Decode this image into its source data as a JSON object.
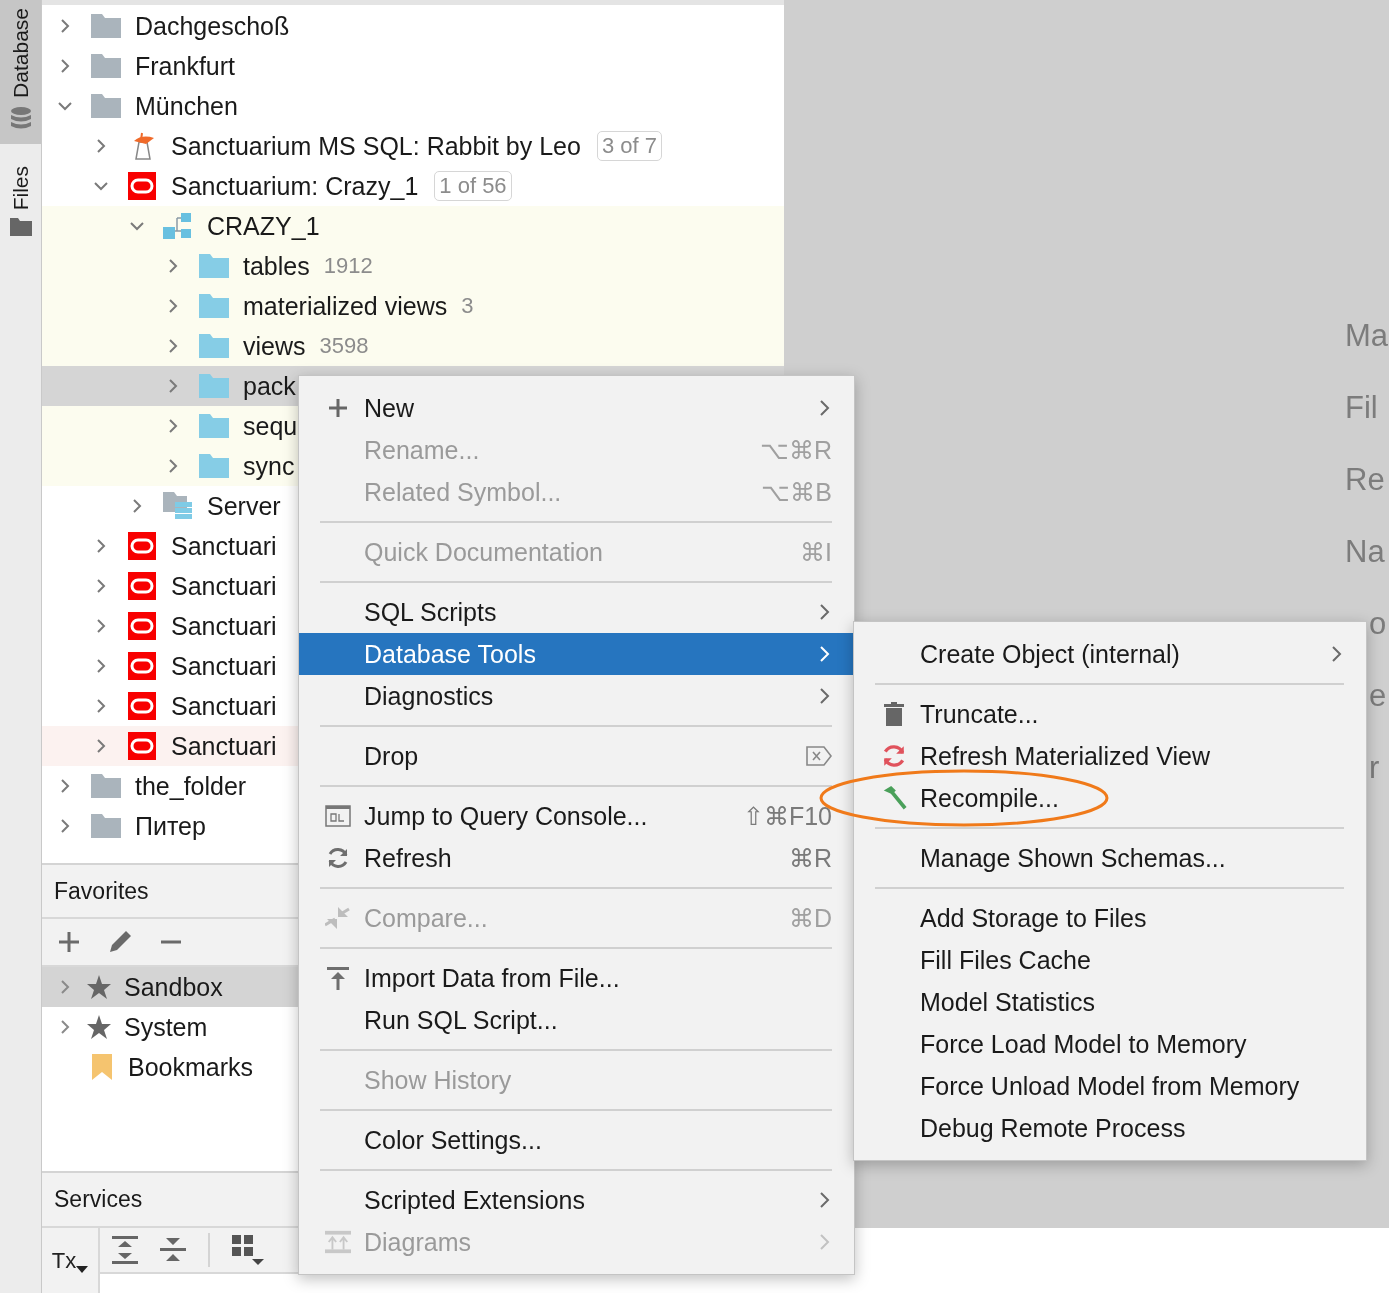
{
  "tool_strip": [
    {
      "label": "Database",
      "selected": true
    },
    {
      "label": "Files",
      "selected": false
    }
  ],
  "tree": [
    {
      "label": "Dachgeschoß",
      "kind": "folder",
      "expanded": false
    },
    {
      "label": "Frankfurt",
      "kind": "folder",
      "expanded": false
    },
    {
      "label": "München",
      "kind": "folder",
      "expanded": true,
      "children": [
        {
          "label": "Sanctuarium MS SQL: Rabbit by Leo",
          "kind": "mssql",
          "expanded": false,
          "badge": "3 of 7"
        },
        {
          "label": "Sanctuarium: Crazy_1",
          "kind": "oracle",
          "expanded": true,
          "badge": "1 of 56",
          "children": [
            {
              "label": "CRAZY_1",
              "kind": "schema",
              "expanded": true,
              "color": "#fcfcef",
              "children": [
                {
                  "label": "tables",
                  "kind": "group",
                  "expanded": false,
                  "count": "1912",
                  "color": "#fcfcef"
                },
                {
                  "label": "materialized views",
                  "kind": "group",
                  "expanded": false,
                  "count": "3",
                  "color": "#fcfcef"
                },
                {
                  "label": "views",
                  "kind": "group",
                  "expanded": false,
                  "count": "3598",
                  "color": "#fcfcef"
                },
                {
                  "label": "pack",
                  "kind": "group",
                  "expanded": false,
                  "selected": true
                },
                {
                  "label": "sequ",
                  "kind": "group",
                  "expanded": false,
                  "color": "#fcfcef"
                },
                {
                  "label": "sync",
                  "kind": "group",
                  "expanded": false,
                  "color": "#fcfcef"
                }
              ]
            },
            {
              "label": "Server",
              "kind": "server",
              "expanded": false
            }
          ]
        },
        {
          "label": "Sanctuari",
          "kind": "oracle",
          "expanded": false
        },
        {
          "label": "Sanctuari",
          "kind": "oracle",
          "expanded": false
        },
        {
          "label": "Sanctuari",
          "kind": "oracle",
          "expanded": false
        },
        {
          "label": "Sanctuari",
          "kind": "oracle",
          "expanded": false
        },
        {
          "label": "Sanctuari",
          "kind": "oracle",
          "expanded": false
        },
        {
          "label": "Sanctuari",
          "kind": "oracle",
          "expanded": false,
          "color": "#fcf2f0"
        }
      ]
    },
    {
      "label": "the_folder",
      "kind": "folder",
      "expanded": false
    },
    {
      "label": "Питер",
      "kind": "folder",
      "expanded": false
    }
  ],
  "favorites": {
    "title": "Favorites",
    "items": [
      {
        "label": "Sandbox",
        "kind": "star",
        "expanded": false,
        "selected": true
      },
      {
        "label": "System",
        "kind": "star",
        "expanded": false,
        "selected": false
      },
      {
        "label": "Bookmarks",
        "kind": "bookmark",
        "selected": false
      }
    ]
  },
  "services": {
    "title": "Services",
    "tx_button": "Tx"
  },
  "right_hints": [
    {
      "label": "Ma"
    },
    {
      "label": "Fil"
    },
    {
      "label": "Re"
    },
    {
      "label": "Na"
    },
    {
      "label": "o",
      "kind": "cut"
    },
    {
      "label": "e",
      "kind": "cut"
    },
    {
      "label": "r",
      "kind": "cut"
    }
  ],
  "context_menu": [
    {
      "kind": "item",
      "label": "New",
      "submenu": true,
      "disabled": false,
      "selected": false
    },
    {
      "kind": "item",
      "label": "Rename...",
      "shortcut": "⌥⌘R",
      "disabled": true,
      "selected": false
    },
    {
      "kind": "item",
      "label": "Related Symbol...",
      "shortcut": "⌥⌘B",
      "disabled": true,
      "selected": false
    },
    {
      "kind": "separator"
    },
    {
      "kind": "item",
      "label": "Quick Documentation",
      "shortcut": "⌘I",
      "disabled": true,
      "selected": false
    },
    {
      "kind": "separator"
    },
    {
      "kind": "item",
      "label": "SQL Scripts",
      "submenu": true,
      "disabled": false,
      "selected": false
    },
    {
      "kind": "item",
      "label": "Database Tools",
      "submenu": true,
      "disabled": false,
      "selected": true
    },
    {
      "kind": "item",
      "label": "Diagnostics",
      "submenu": true,
      "disabled": false,
      "selected": false
    },
    {
      "kind": "separator"
    },
    {
      "kind": "item",
      "label": "Drop",
      "disabled": false,
      "selected": false
    },
    {
      "kind": "separator"
    },
    {
      "kind": "item",
      "label": "Jump to Query Console...",
      "shortcut": "⇧⌘F10",
      "disabled": false,
      "selected": false
    },
    {
      "kind": "item",
      "label": "Refresh",
      "shortcut": "⌘R",
      "disabled": false,
      "selected": false
    },
    {
      "kind": "separator"
    },
    {
      "kind": "item",
      "label": "Compare...",
      "shortcut": "⌘D",
      "disabled": true,
      "selected": false
    },
    {
      "kind": "separator"
    },
    {
      "kind": "item",
      "label": "Import Data from File...",
      "disabled": false,
      "selected": false
    },
    {
      "kind": "item",
      "label": "Run SQL Script...",
      "disabled": false,
      "selected": false
    },
    {
      "kind": "separator"
    },
    {
      "kind": "item",
      "label": "Show History",
      "disabled": true,
      "selected": false
    },
    {
      "kind": "separator"
    },
    {
      "kind": "item",
      "label": "Color Settings...",
      "disabled": false,
      "selected": false
    },
    {
      "kind": "separator"
    },
    {
      "kind": "item",
      "label": "Scripted Extensions",
      "submenu": true,
      "disabled": false,
      "selected": false
    },
    {
      "kind": "item",
      "label": "Diagrams",
      "submenu": true,
      "disabled": true,
      "selected": false
    }
  ],
  "submenu": [
    {
      "kind": "item",
      "label": "Create Object (internal)",
      "submenu": true
    },
    {
      "kind": "separator"
    },
    {
      "kind": "item",
      "label": "Truncate..."
    },
    {
      "kind": "item",
      "label": "Refresh Materialized View"
    },
    {
      "kind": "item",
      "label": "Recompile...",
      "circled": true
    },
    {
      "kind": "separator"
    },
    {
      "kind": "item",
      "label": "Manage Shown Schemas..."
    },
    {
      "kind": "separator"
    },
    {
      "kind": "item",
      "label": "Add Storage to Files"
    },
    {
      "kind": "item",
      "label": "Fill Files Cache"
    },
    {
      "kind": "item",
      "label": "Model Statistics"
    },
    {
      "kind": "item",
      "label": "Force Load Model to Memory"
    },
    {
      "kind": "item",
      "label": "Force Unload Model from Memory"
    },
    {
      "kind": "item",
      "label": "Debug Remote Process"
    }
  ]
}
